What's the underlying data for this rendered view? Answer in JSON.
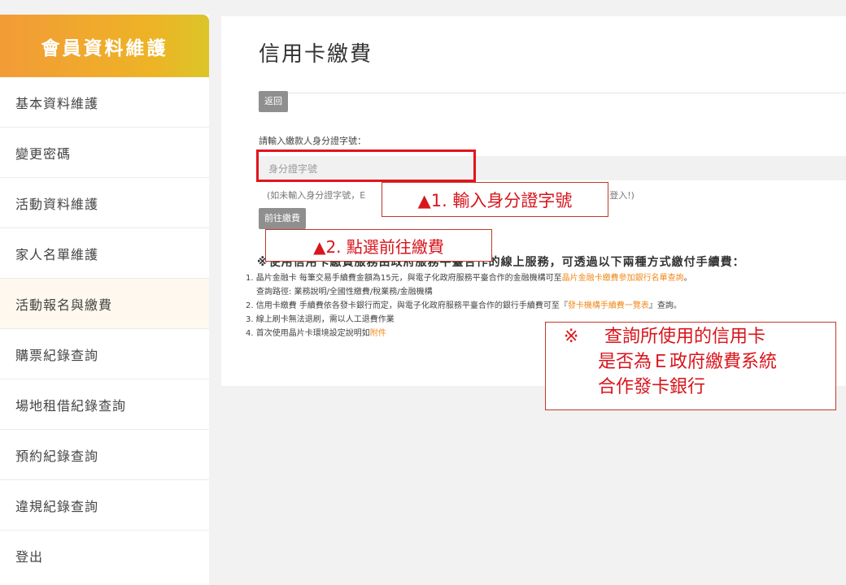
{
  "sidebar": {
    "title": "會員資料維護",
    "items": [
      {
        "label": "基本資料維護"
      },
      {
        "label": "變更密碼"
      },
      {
        "label": "活動資料維護"
      },
      {
        "label": "家人名單維護"
      },
      {
        "label": "活動報名與繳費"
      },
      {
        "label": "購票紀錄查詢"
      },
      {
        "label": "場地租借紀錄查詢"
      },
      {
        "label": "預約紀錄查詢"
      },
      {
        "label": "違規紀錄查詢"
      },
      {
        "label": "登出"
      }
    ]
  },
  "main": {
    "title": "信用卡繳費",
    "back_label": "返回",
    "field_label": "請輸入繳款人身分證字號：",
    "id_placeholder": "身分證字號",
    "hint_prefix": "(如未輸入身分證字號，E",
    "hint_suffix": "登入!)",
    "pay_label": "前往繳費",
    "notice_text": "※使用信用卡繳費服務由政府服務平臺合作的線上服務，可透過以下兩種方式繳付手續費：",
    "notes": {
      "n1_text": "1. 晶片金融卡 每筆交易手續費金額為15元，與電子化政府服務平臺合作的金融機構可至",
      "n1_link": "晶片金融卡繳費參加銀行名單查詢",
      "n1_end": "。",
      "n1_path": "查詢路徑: 業務說明/全國性繳費/稅業務/金融機構",
      "n2_text": "2. 信用卡繳費 手續費依各發卡銀行而定，與電子化政府服務平臺合作的銀行手續費可至『",
      "n2_link": "發卡機構手續費一覽表",
      "n2_end": "』查詢。",
      "n3_text": "3. 線上刷卡無法退刷，需以人工退費作業",
      "n4_text": "4. 首次使用晶片卡環境設定說明如",
      "n4_link": "附件"
    }
  },
  "annotations": {
    "step1": "▲1. 輸入身分證字號",
    "step2": "▲2. 點選前往繳費",
    "note_mark": "※",
    "note_line1": "查詢所使用的信用卡",
    "note_line2": "是否為Ｅ政府繳費系統",
    "note_line3": "合作發卡銀行"
  },
  "colors": {
    "header_gradient_start": "#f29b37",
    "header_gradient_end": "#dcc528",
    "annotation_red": "#e3141c",
    "link_orange": "#f08a1c",
    "button_gray": "#8f8f8f"
  }
}
